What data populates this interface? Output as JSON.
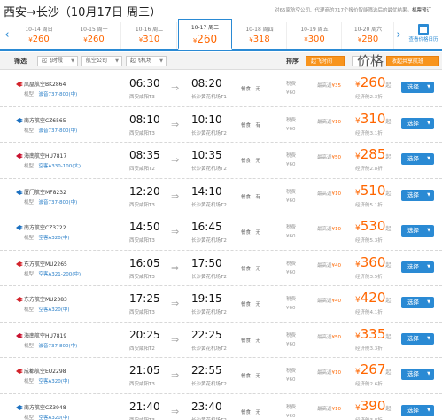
{
  "header": {
    "route": "西安→长沙",
    "date": "（10月17日 周三）",
    "notice_prefix": "对65家航空公司、代理商的717个报价智能筛选后的最优结果。",
    "notice_link": "机票预订"
  },
  "date_strip": {
    "prev_arrow": "‹",
    "next_arrow": "›",
    "currency": "¥",
    "days": [
      {
        "label": "10-14 周日",
        "price": "260"
      },
      {
        "label": "10-15 周一",
        "price": "260"
      },
      {
        "label": "10-16 周二",
        "price": "310"
      },
      {
        "label": "10-17 周三",
        "price": "260",
        "active": true
      },
      {
        "label": "10-18 周四",
        "price": "318"
      },
      {
        "label": "10-19 周五",
        "price": "300"
      },
      {
        "label": "10-20 周六",
        "price": "280"
      }
    ],
    "calendar_label": "查看价格日历"
  },
  "filters": {
    "title": "筛选",
    "dep_time": "起飞时段",
    "airline": "航空公司",
    "dep_airport": "起飞机场",
    "sort_title": "排序",
    "sort_time": "起飞时间",
    "sort_price": "价格",
    "hide_shared": "收起共享航班"
  },
  "list_labels": {
    "model_prefix": "机型：",
    "tax_label": "税费",
    "tax_value": "¥60",
    "promo_prefix": "最高返",
    "currency": "¥",
    "from": "起",
    "select": "选择",
    "caret": "▼",
    "arrow": "⇒"
  },
  "flights": [
    {
      "airline": "凤凰航空BK2864",
      "logo_color": "#d2222a",
      "model": "波音737-800(中)",
      "dep": "06:30",
      "dep_ap": "西安咸阳T3",
      "arr": "08:20",
      "arr_ap": "长沙黄花机场T1",
      "meal": "餐食：无",
      "promo": "¥35",
      "price": "260",
      "discount": "经济舱2.3折"
    },
    {
      "airline": "南方航空CZ6565",
      "logo_color": "#1a6fc0",
      "model": "波音737-800(中)",
      "dep": "08:10",
      "dep_ap": "西安咸阳T3",
      "arr": "10:10",
      "arr_ap": "长沙黄花机场T2",
      "meal": "餐食：有",
      "promo": "¥10",
      "price": "310",
      "discount": "经济舱3.1折"
    },
    {
      "airline": "海南航空HU7817",
      "logo_color": "#c8102e",
      "model": "空客A330-100(大)",
      "dep": "08:35",
      "dep_ap": "西安咸阳T2",
      "arr": "10:35",
      "arr_ap": "长沙黄花机场T2",
      "meal": "餐食：无",
      "promo": "¥50",
      "price": "285",
      "discount": "经济舱2.8折"
    },
    {
      "airline": "厦门航空MF8232",
      "logo_color": "#1a6fc0",
      "model": "波音737-800(中)",
      "dep": "12:20",
      "dep_ap": "西安咸阳T3",
      "arr": "14:10",
      "arr_ap": "长沙黄花机场T2",
      "meal": "餐食：有",
      "promo": "¥10",
      "price": "510",
      "discount": "经济舱5.1折"
    },
    {
      "airline": "南方航空CZ3722",
      "logo_color": "#1a6fc0",
      "model": "空客A320(中)",
      "dep": "14:50",
      "dep_ap": "西安咸阳T3",
      "arr": "16:45",
      "arr_ap": "长沙黄花机场T2",
      "meal": "餐食：无",
      "promo": "¥10",
      "price": "530",
      "discount": "经济舱5.3折"
    },
    {
      "airline": "东方航空MU2265",
      "logo_color": "#d2222a",
      "model": "空客A321-200(中)",
      "dep": "16:05",
      "dep_ap": "西安咸阳T3",
      "arr": "17:50",
      "arr_ap": "长沙黄花机场T2",
      "meal": "餐食：无",
      "promo": "¥40",
      "price": "360",
      "discount": "经济舱3.5折"
    },
    {
      "airline": "东方航空MU2383",
      "logo_color": "#d2222a",
      "model": "空客A320(中)",
      "dep": "17:25",
      "dep_ap": "西安咸阳T3",
      "arr": "19:15",
      "arr_ap": "长沙黄花机场T2",
      "meal": "餐食：无",
      "promo": "¥40",
      "price": "420",
      "discount": "经济舱4.1折"
    },
    {
      "airline": "海南航空HU7819",
      "logo_color": "#c8102e",
      "model": "波音737-800(中)",
      "dep": "20:25",
      "dep_ap": "西安咸阳T2",
      "arr": "22:25",
      "arr_ap": "长沙黄花机场T2",
      "meal": "餐食：无",
      "promo": "¥50",
      "price": "335",
      "discount": "经济舱3.3折"
    },
    {
      "airline": "成都航空EU2298",
      "logo_color": "#d2222a",
      "model": "空客A320(中)",
      "dep": "21:05",
      "dep_ap": "西安咸阳T3",
      "arr": "22:55",
      "arr_ap": "长沙黄花机场T2",
      "meal": "餐食：无",
      "promo": "¥10",
      "price": "267",
      "discount": "经济舱2.6折"
    },
    {
      "airline": "南方航空CZ3948",
      "logo_color": "#1a6fc0",
      "model": "空客A320(中)",
      "dep": "21:40",
      "dep_ap": "西安咸阳T3",
      "arr": "23:40",
      "arr_ap": "长沙黄花机场T2",
      "meal": "餐食：无",
      "promo": "¥10",
      "price": "390",
      "discount": "经济舱3.8折"
    }
  ]
}
